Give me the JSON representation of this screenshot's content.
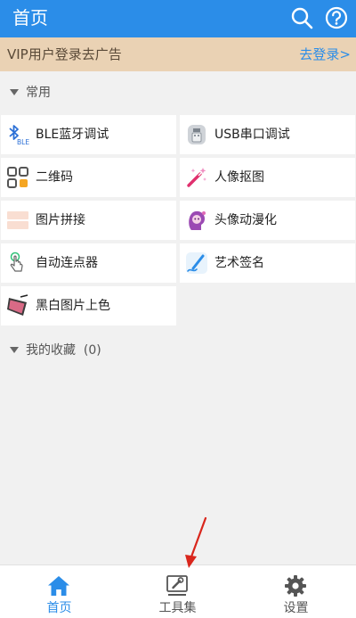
{
  "header": {
    "title": "首页",
    "search_icon": "search-icon",
    "help_icon": "help-icon"
  },
  "vip": {
    "message": "VIP用户登录去广告",
    "login_link": "去登录>"
  },
  "sections": {
    "common": "常用",
    "favorites": "我的收藏",
    "favorites_count": "(0)"
  },
  "tools": [
    {
      "label": "BLE蓝牙调试",
      "icon": "bluetooth-ble-icon"
    },
    {
      "label": "USB串口调试",
      "icon": "usb-icon"
    },
    {
      "label": "二维码",
      "icon": "qr-code-icon"
    },
    {
      "label": "人像抠图",
      "icon": "magic-wand-icon"
    },
    {
      "label": "图片拼接",
      "icon": "image-stitch-icon"
    },
    {
      "label": "头像动漫化",
      "icon": "anime-avatar-icon"
    },
    {
      "label": "自动连点器",
      "icon": "auto-clicker-icon"
    },
    {
      "label": "艺术签名",
      "icon": "signature-pen-icon"
    },
    {
      "label": "黑白图片上色",
      "icon": "colorize-icon"
    }
  ],
  "bottom_nav": [
    {
      "label": "首页",
      "icon": "home-icon",
      "active": true
    },
    {
      "label": "工具集",
      "icon": "toolbox-icon",
      "active": false
    },
    {
      "label": "设置",
      "icon": "settings-gear-icon",
      "active": false
    }
  ],
  "colors": {
    "primary": "#2b8de8",
    "vip_bar": "#ead2b4",
    "background": "#f1f1f1",
    "annotation_arrow": "#d9261c"
  }
}
